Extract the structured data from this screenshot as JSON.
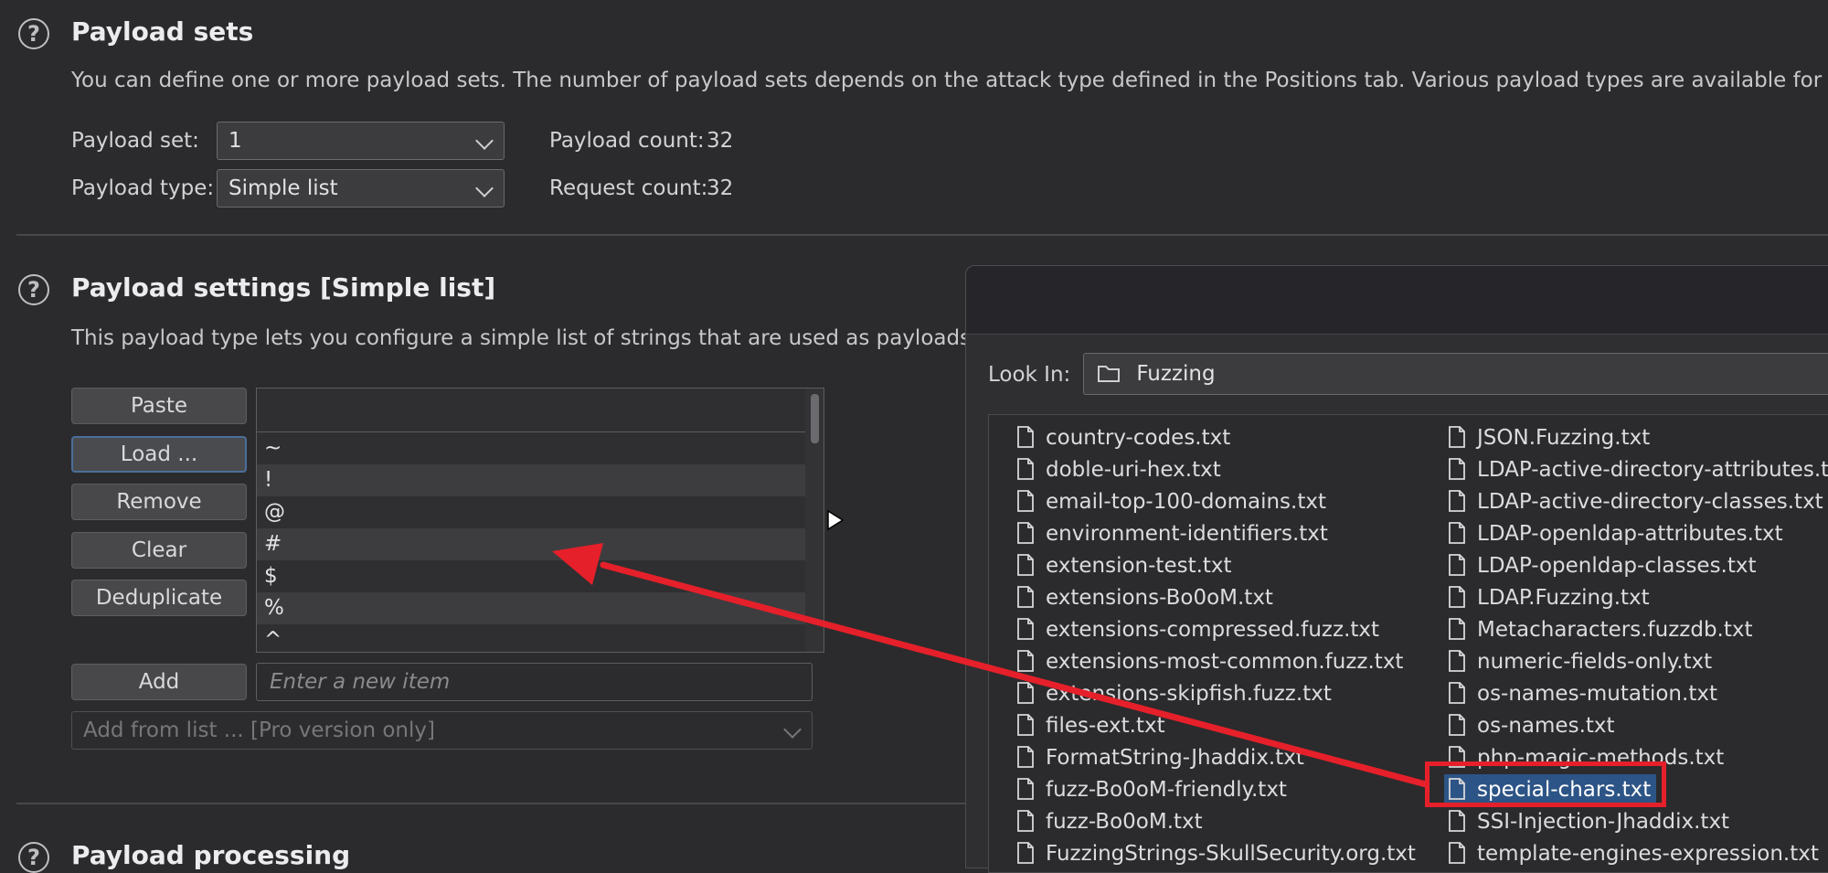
{
  "payload_sets": {
    "title": "Payload sets",
    "description": "You can define one or more payload sets. The number of payload sets depends on the attack type defined in the Positions tab. Various payload types are available for each payload set",
    "payload_set_label": "Payload set:",
    "payload_set_value": "1",
    "payload_type_label": "Payload type:",
    "payload_type_value": "Simple list",
    "payload_count_label": "Payload count:",
    "payload_count_value": "32",
    "request_count_label": "Request count:",
    "request_count_value": "32"
  },
  "payload_settings": {
    "title": "Payload settings [Simple list]",
    "description": "This payload type lets you configure a simple list of strings that are used as payloads.",
    "buttons": {
      "paste": "Paste",
      "load": "Load ...",
      "remove": "Remove",
      "clear": "Clear",
      "deduplicate": "Deduplicate",
      "add": "Add"
    },
    "list_items": [
      "~",
      "!",
      "@",
      "#",
      "$",
      "%",
      "^"
    ],
    "new_item_placeholder": "Enter a new item",
    "add_from_list": "Add from list ... [Pro version only]"
  },
  "payload_processing": {
    "title": "Payload processing"
  },
  "file_dialog": {
    "look_in_label": "Look In:",
    "look_in_value": "Fuzzing",
    "files_col1": [
      "country-codes.txt",
      "doble-uri-hex.txt",
      "email-top-100-domains.txt",
      "environment-identifiers.txt",
      "extension-test.txt",
      "extensions-Bo0oM.txt",
      "extensions-compressed.fuzz.txt",
      "extensions-most-common.fuzz.txt",
      "extensions-skipfish.fuzz.txt",
      "files-ext.txt",
      "FormatString-Jhaddix.txt",
      "fuzz-Bo0oM-friendly.txt",
      "fuzz-Bo0oM.txt",
      "FuzzingStrings-SkullSecurity.org.txt"
    ],
    "files_col2": [
      "JSON.Fuzzing.txt",
      "LDAP-active-directory-attributes.txt",
      "LDAP-active-directory-classes.txt",
      "LDAP-openldap-attributes.txt",
      "LDAP-openldap-classes.txt",
      "LDAP.Fuzzing.txt",
      "Metacharacters.fuzzdb.txt",
      "numeric-fields-only.txt",
      "os-names-mutation.txt",
      "os-names.txt",
      "php-magic-methods.txt",
      "special-chars.txt",
      "SSI-Injection-Jhaddix.txt",
      "template-engines-expression.txt"
    ],
    "selected_file": "special-chars.txt"
  },
  "colors": {
    "background": "#2b2b2d",
    "selection": "#2d5486",
    "annotation_red": "#e5202a"
  }
}
